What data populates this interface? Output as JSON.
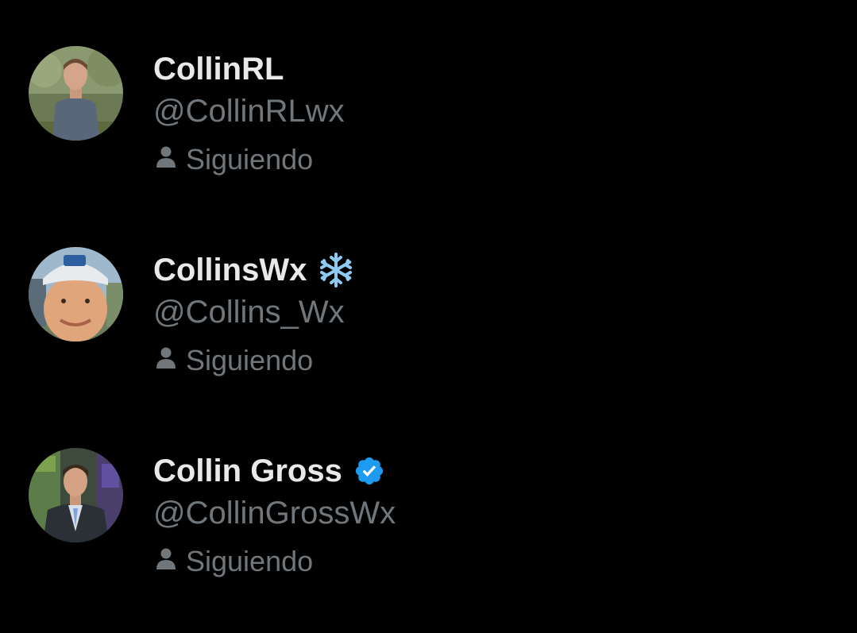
{
  "users": [
    {
      "display_name": "CollinRL",
      "handle": "@CollinRLwx",
      "badge": null,
      "follow_status": "Siguiendo"
    },
    {
      "display_name": "CollinsWx",
      "handle": "@Collins_Wx",
      "badge": "snowflake-icon",
      "follow_status": "Siguiendo"
    },
    {
      "display_name": "Collin Gross",
      "handle": "@CollinGrossWx",
      "badge": "verified-badge-icon",
      "follow_status": "Siguiendo"
    }
  ],
  "colors": {
    "background": "#000000",
    "name": "#e7e9ea",
    "secondary": "#71767b",
    "verified": "#1d9bf0",
    "snowflake": "#8ec9f2"
  }
}
